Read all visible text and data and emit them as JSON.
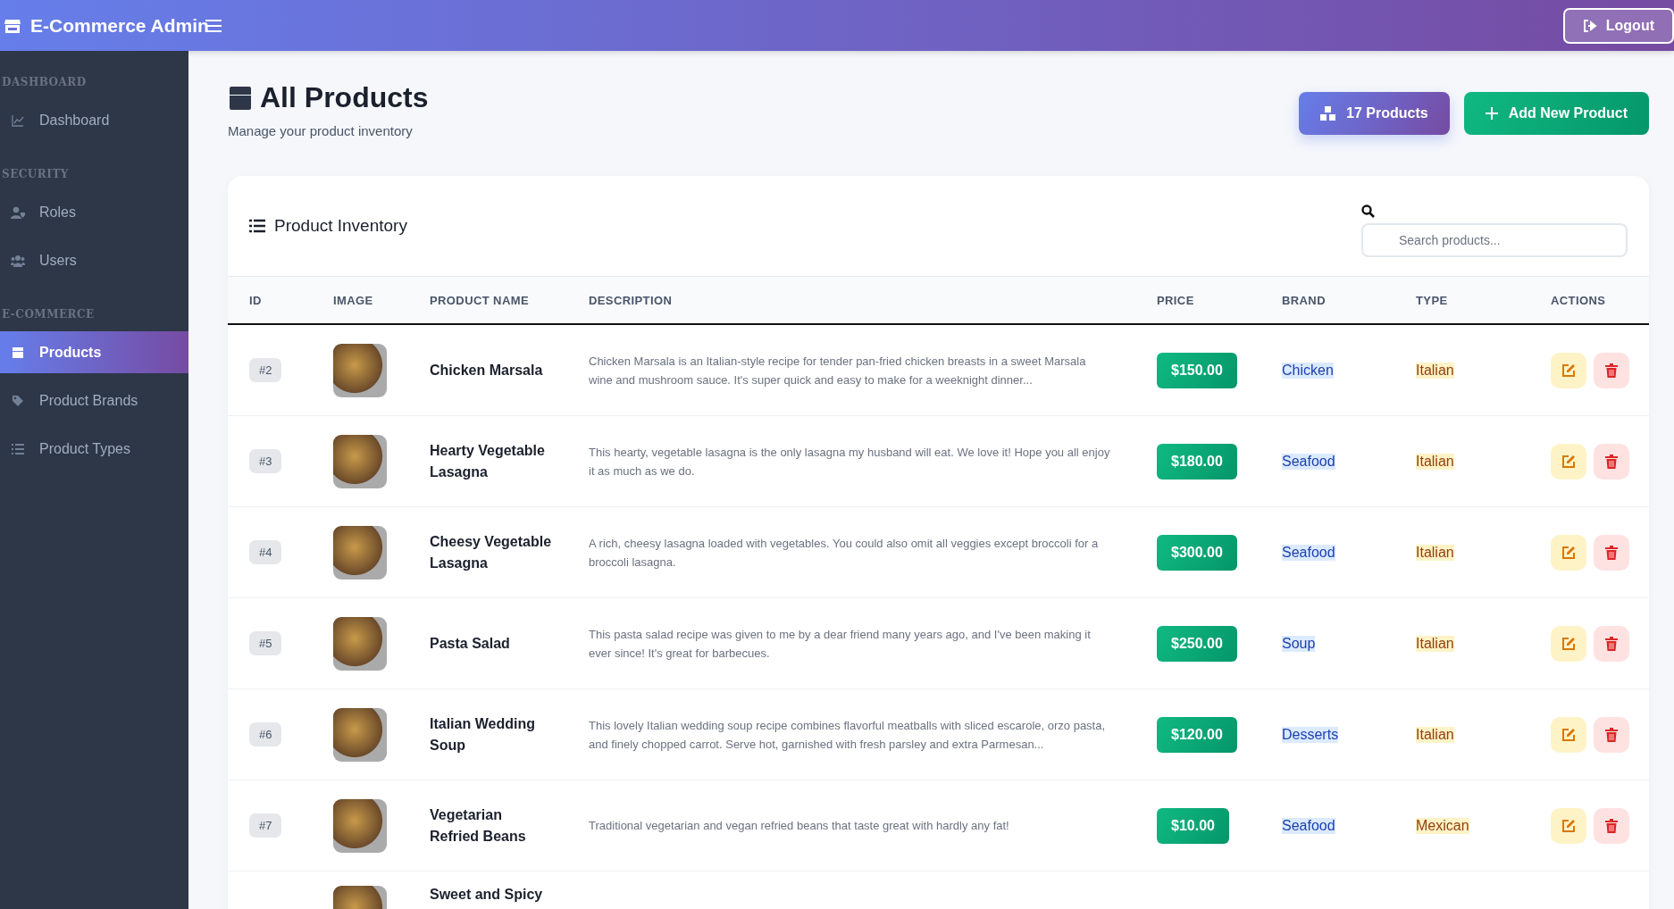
{
  "header": {
    "brand": "E-Commerce Admin",
    "logout": "Logout"
  },
  "sidebar": {
    "sections": [
      {
        "title": "DASHBOARD",
        "items": [
          {
            "label": "Dashboard",
            "selected": false
          }
        ]
      },
      {
        "title": "SECURITY",
        "items": [
          {
            "label": "Roles",
            "selected": false
          },
          {
            "label": "Users",
            "selected": false
          }
        ]
      },
      {
        "title": "E-COMMERCE",
        "items": [
          {
            "label": "Products",
            "selected": true
          },
          {
            "label": "Product Brands",
            "selected": false
          },
          {
            "label": "Product Types",
            "selected": false
          }
        ]
      }
    ]
  },
  "page": {
    "title": "All Products",
    "subtitle": "Manage your product inventory",
    "count_button": "17 Products",
    "add_button": "Add New Product"
  },
  "inventory": {
    "title": "Product Inventory",
    "search": {
      "placeholder": "Search products..."
    },
    "columns": [
      "ID",
      "IMAGE",
      "PRODUCT NAME",
      "DESCRIPTION",
      "PRICE",
      "BRAND",
      "TYPE",
      "ACTIONS"
    ],
    "rows": [
      {
        "id": "#2",
        "name": "Chicken Marsala",
        "description": "Chicken Marsala is an Italian-style recipe for tender pan-fried chicken breasts in a sweet Marsala wine and mushroom sauce. It's super quick and easy to make for a weeknight dinner...",
        "price": "$150.00",
        "brand": "Chicken",
        "type": "Italian"
      },
      {
        "id": "#3",
        "name": "Hearty Vegetable Lasagna",
        "description": "This hearty, vegetable lasagna is the only lasagna my husband will eat. We love it! Hope you all enjoy it as much as we do.",
        "price": "$180.00",
        "brand": "Seafood",
        "type": "Italian"
      },
      {
        "id": "#4",
        "name": "Cheesy Vegetable Lasagna",
        "description": "A rich, cheesy lasagna loaded with vegetables. You could also omit all veggies except broccoli for a broccoli lasagna.",
        "price": "$300.00",
        "brand": "Seafood",
        "type": "Italian"
      },
      {
        "id": "#5",
        "name": "Pasta Salad",
        "description": "This pasta salad recipe was given to me by a dear friend many years ago, and I've been making it ever since! It's great for barbecues.",
        "price": "$250.00",
        "brand": "Soup",
        "type": "Italian"
      },
      {
        "id": "#6",
        "name": "Italian Wedding Soup",
        "description": "This lovely Italian wedding soup recipe combines flavorful meatballs with sliced escarole, orzo pasta, and finely chopped carrot. Serve hot, garnished with fresh parsley and extra Parmesan...",
        "price": "$120.00",
        "brand": "Desserts",
        "type": "Italian"
      },
      {
        "id": "#7",
        "name": "Vegetarian Refried Beans",
        "description": "Traditional vegetarian and vegan refried beans that taste great with hardly any fat!",
        "price": "$10.00",
        "brand": "Seafood",
        "type": "Mexican"
      },
      {
        "name": "Sweet and Spicy"
      }
    ]
  }
}
